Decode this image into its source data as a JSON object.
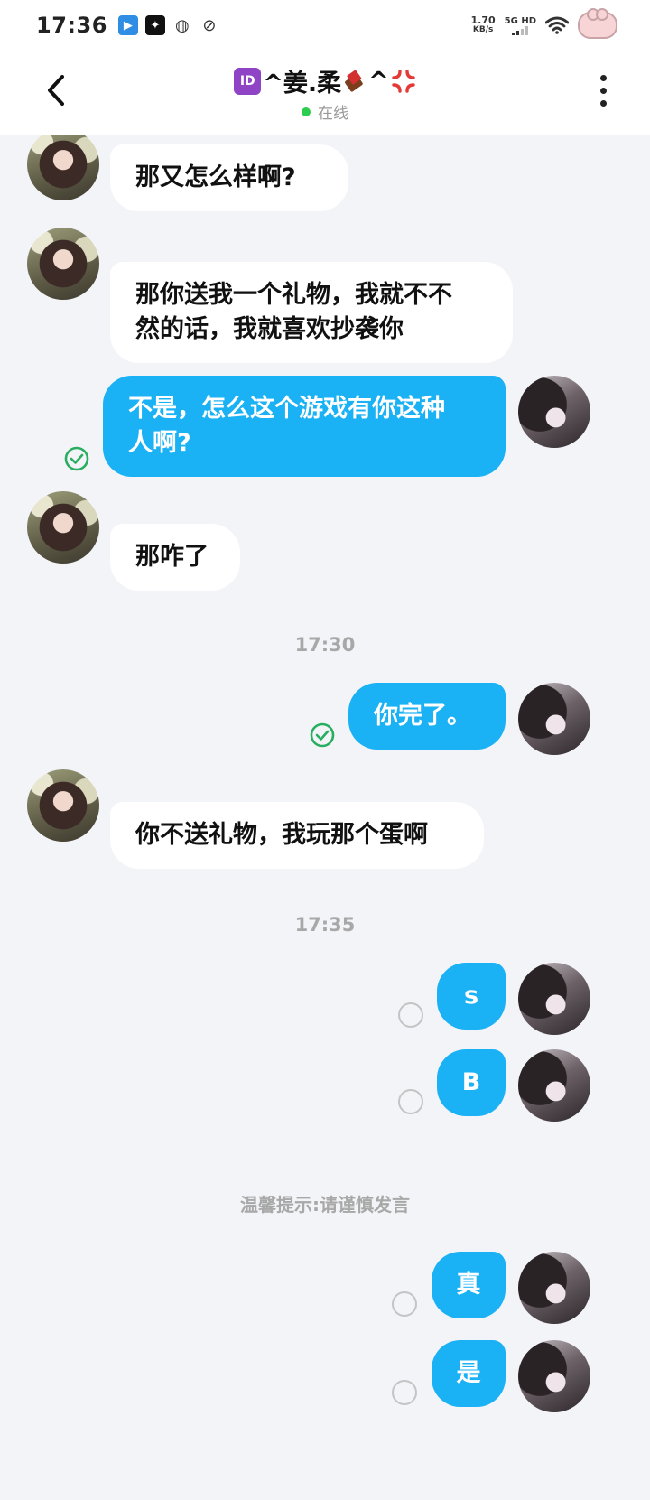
{
  "status_bar": {
    "time": "17:36",
    "net_speed_value": "1.70",
    "net_speed_unit": "KB/s",
    "network_label": "5G HD"
  },
  "header": {
    "title_prefix": "^姜.柔",
    "title_suffix": "^",
    "id_badge": "ID",
    "status": "在线",
    "icons": [
      "back-arrow",
      "id-badge",
      "chocolate",
      "anger-symbol",
      "more-vertical"
    ]
  },
  "messages": [
    {
      "from": "peer",
      "lines": [
        "那又怎么样啊?"
      ]
    },
    {
      "from": "peer",
      "lines": [
        "那你送我一个礼物，我就不不",
        "然的话，我就喜欢抄袭你"
      ]
    },
    {
      "from": "me",
      "lines": [
        "不是，怎么这个游戏有你这种",
        "人啊?"
      ],
      "status": "read"
    },
    {
      "from": "peer",
      "lines": [
        "那咋了"
      ]
    },
    {
      "from": "me",
      "lines": [
        "你完了。"
      ],
      "status": "read"
    },
    {
      "from": "peer",
      "lines": [
        "你不送礼物，我玩那个蛋啊"
      ]
    },
    {
      "from": "me",
      "lines": [
        "s"
      ],
      "status": "unread"
    },
    {
      "from": "me",
      "lines": [
        "B"
      ],
      "status": "unread"
    },
    {
      "from": "me",
      "lines": [
        "真"
      ],
      "status": "unread"
    },
    {
      "from": "me",
      "lines": [
        "是"
      ],
      "status": "unread"
    }
  ],
  "timestamps": [
    "17:30",
    "17:35"
  ],
  "notice": "温馨提示:请谨慎发言",
  "colors": {
    "outgoing_bubble": "#1ab1f5",
    "incoming_bubble": "#ffffff",
    "background": "#f3f4f8",
    "read_check": "#27ae60",
    "online_dot": "#2ecc4f"
  }
}
